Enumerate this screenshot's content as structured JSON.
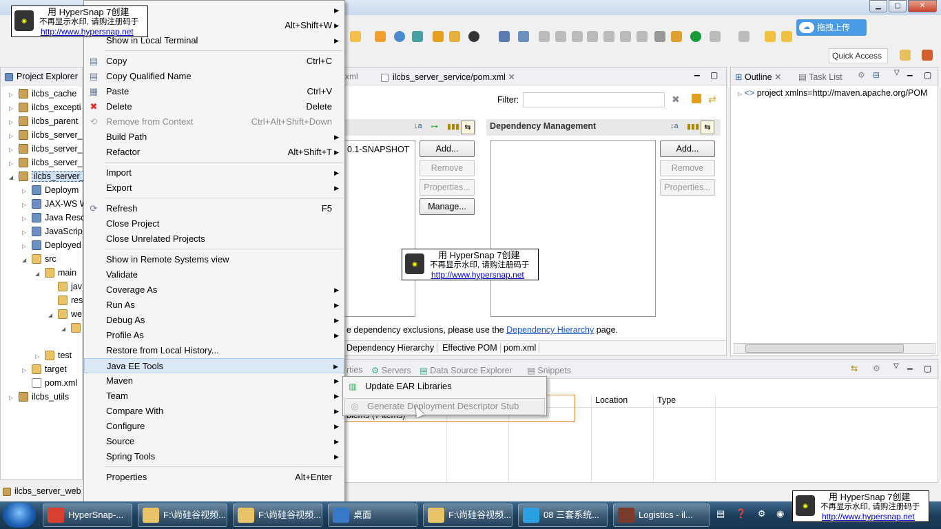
{
  "window": {
    "min": "▁",
    "max": "▢",
    "close": "✕"
  },
  "quick_access": "Quick Access",
  "upload_label": "拖拽上传",
  "project_explorer": {
    "title": "Project Explorer",
    "items": [
      {
        "label": "ilcbs_cache",
        "depth": 0,
        "icon": "proj",
        "twisty": "▷"
      },
      {
        "label": "ilcbs_excepti",
        "depth": 0,
        "icon": "proj",
        "twisty": "▷"
      },
      {
        "label": "ilcbs_parent",
        "depth": 0,
        "icon": "proj",
        "twisty": "▷"
      },
      {
        "label": "ilcbs_server_",
        "depth": 0,
        "icon": "proj",
        "twisty": "▷"
      },
      {
        "label": "ilcbs_server_",
        "depth": 0,
        "icon": "proj",
        "twisty": "▷"
      },
      {
        "label": "ilcbs_server_",
        "depth": 0,
        "icon": "proj",
        "twisty": "▷"
      },
      {
        "label": "ilcbs_server_",
        "depth": 0,
        "icon": "proj",
        "twisty": "◢",
        "selected": true
      },
      {
        "label": "Deploym",
        "depth": 1,
        "icon": "misc",
        "twisty": "▷"
      },
      {
        "label": "JAX-WS W",
        "depth": 1,
        "icon": "misc",
        "twisty": "▷"
      },
      {
        "label": "Java Reso",
        "depth": 1,
        "icon": "misc",
        "twisty": "▷"
      },
      {
        "label": "JavaScrip",
        "depth": 1,
        "icon": "misc",
        "twisty": "▷"
      },
      {
        "label": "Deployed",
        "depth": 1,
        "icon": "misc",
        "twisty": "▷"
      },
      {
        "label": "src",
        "depth": 1,
        "icon": "fold",
        "twisty": "◢"
      },
      {
        "label": "main",
        "depth": 2,
        "icon": "fold",
        "twisty": "◢"
      },
      {
        "label": "jav",
        "depth": 3,
        "icon": "fold",
        "twisty": ""
      },
      {
        "label": "res",
        "depth": 3,
        "icon": "fold",
        "twisty": ""
      },
      {
        "label": "we",
        "depth": 3,
        "icon": "fold",
        "twisty": "◢"
      },
      {
        "label": "",
        "depth": 4,
        "icon": "fold",
        "twisty": "◢"
      },
      {
        "label": "",
        "depth": 0,
        "icon": "",
        "twisty": ""
      },
      {
        "label": "test",
        "depth": 2,
        "icon": "fold",
        "twisty": "▷"
      },
      {
        "label": "target",
        "depth": 1,
        "icon": "fold",
        "twisty": "▷"
      },
      {
        "label": "pom.xml",
        "depth": 1,
        "icon": "file",
        "twisty": ""
      },
      {
        "label": "ilcbs_utils",
        "depth": 0,
        "icon": "proj",
        "twisty": "▷"
      }
    ],
    "status": "ilcbs_server_web"
  },
  "context_menu": {
    "items": [
      {
        "type": "item",
        "label": "",
        "shortcut": "",
        "submenu": true
      },
      {
        "type": "item",
        "label": "Show In",
        "shortcut": "Alt+Shift+W",
        "submenu": true
      },
      {
        "type": "item",
        "label": "Show in Local Terminal",
        "shortcut": "",
        "submenu": true
      },
      {
        "type": "sep"
      },
      {
        "type": "item",
        "label": "Copy",
        "shortcut": "Ctrl+C",
        "icon": "copy-icon",
        "glyph": "▤"
      },
      {
        "type": "item",
        "label": "Copy Qualified Name",
        "shortcut": "",
        "icon": "copy-qualified-icon",
        "glyph": "▤"
      },
      {
        "type": "item",
        "label": "Paste",
        "shortcut": "Ctrl+V",
        "icon": "paste-icon",
        "glyph": "▦"
      },
      {
        "type": "item",
        "label": "Delete",
        "shortcut": "Delete",
        "icon": "delete-icon",
        "glyph": "✖",
        "glyph_color": "#e0282b"
      },
      {
        "type": "item",
        "label": "Remove from Context",
        "shortcut": "Ctrl+Alt+Shift+Down",
        "disabled": true,
        "icon": "remove-context-icon",
        "glyph": "⟲"
      },
      {
        "type": "item",
        "label": "Build Path",
        "shortcut": "",
        "submenu": true
      },
      {
        "type": "item",
        "label": "Refactor",
        "shortcut": "Alt+Shift+T",
        "submenu": true
      },
      {
        "type": "sep"
      },
      {
        "type": "item",
        "label": "Import",
        "shortcut": "",
        "submenu": true
      },
      {
        "type": "item",
        "label": "Export",
        "shortcut": "",
        "submenu": true
      },
      {
        "type": "sep"
      },
      {
        "type": "item",
        "label": "Refresh",
        "shortcut": "F5",
        "icon": "refresh-icon",
        "glyph": "⟳"
      },
      {
        "type": "item",
        "label": "Close Project",
        "shortcut": ""
      },
      {
        "type": "item",
        "label": "Close Unrelated Projects",
        "shortcut": ""
      },
      {
        "type": "sep"
      },
      {
        "type": "item",
        "label": "Show in Remote Systems view",
        "shortcut": ""
      },
      {
        "type": "item",
        "label": "Validate",
        "shortcut": ""
      },
      {
        "type": "item",
        "label": "Coverage As",
        "shortcut": "",
        "submenu": true
      },
      {
        "type": "item",
        "label": "Run As",
        "shortcut": "",
        "submenu": true
      },
      {
        "type": "item",
        "label": "Debug As",
        "shortcut": "",
        "submenu": true
      },
      {
        "type": "item",
        "label": "Profile As",
        "shortcut": "",
        "submenu": true
      },
      {
        "type": "item",
        "label": "Restore from Local History...",
        "shortcut": ""
      },
      {
        "type": "item",
        "label": "Java EE Tools",
        "shortcut": "",
        "submenu": true,
        "highlight": true
      },
      {
        "type": "item",
        "label": "Maven",
        "shortcut": "",
        "submenu": true
      },
      {
        "type": "item",
        "label": "Team",
        "shortcut": "",
        "submenu": true
      },
      {
        "type": "item",
        "label": "Compare With",
        "shortcut": "",
        "submenu": true
      },
      {
        "type": "item",
        "label": "Configure",
        "shortcut": "",
        "submenu": true
      },
      {
        "type": "item",
        "label": "Source",
        "shortcut": "",
        "submenu": true
      },
      {
        "type": "item",
        "label": "Spring Tools",
        "shortcut": "",
        "submenu": true
      },
      {
        "type": "sep"
      },
      {
        "type": "item",
        "label": "Properties",
        "shortcut": "Alt+Enter"
      }
    ]
  },
  "submenu": {
    "update_ear": "Update EAR Libraries",
    "generate_stub": "Generate Deployment Descriptor Stub"
  },
  "editor": {
    "tab_prev": "xml",
    "tab_active": "ilcbs_server_service/pom.xml",
    "filter_label": "Filter:",
    "dependency_item": "0.1-SNAPSHOT",
    "dep_mgmt_title": "Dependency Management",
    "btn_add": "Add...",
    "btn_remove": "Remove",
    "btn_properties": "Properties...",
    "btn_manage": "Manage...",
    "exclusion_text": "e dependency exclusions, please use the ",
    "exclusion_link": "Dependency Hierarchy",
    "exclusion_suffix": " page.",
    "bottom_tabs": [
      "Dependency Hierarchy",
      "Effective POM",
      "pom.xml"
    ]
  },
  "outline": {
    "title": "Outline",
    "task_list": "Task List",
    "node": "project xmlns=http://maven.apache.org/POM"
  },
  "bottom_panel": {
    "tabs": [
      "rties",
      "Servers",
      "Data Source Explorer",
      "Snippets"
    ],
    "columns": [
      "Location",
      "Type"
    ],
    "row_text": "blems (7 items)"
  },
  "watermark": {
    "line1": "用 HyperSnap 7创建",
    "line2": "不再显示水印, 请购注册码于",
    "url": "http://www.hypersnap.net"
  },
  "taskbar": {
    "items": [
      {
        "label": "HyperSnap-...",
        "color": "#d8412f"
      },
      {
        "label": "F:\\尚硅谷视频...",
        "color": "#e8c36a"
      },
      {
        "label": "F:\\尚硅谷视频...",
        "color": "#e8c36a"
      },
      {
        "label": "桌面",
        "color": "#3a78c8"
      },
      {
        "label": "F:\\尚硅谷视频...",
        "color": "#e8c36a"
      },
      {
        "label": "08 三套系统...",
        "color": "#2aa0e0"
      },
      {
        "label": "Logistics - il...",
        "color": "#7a3b2a"
      }
    ]
  }
}
